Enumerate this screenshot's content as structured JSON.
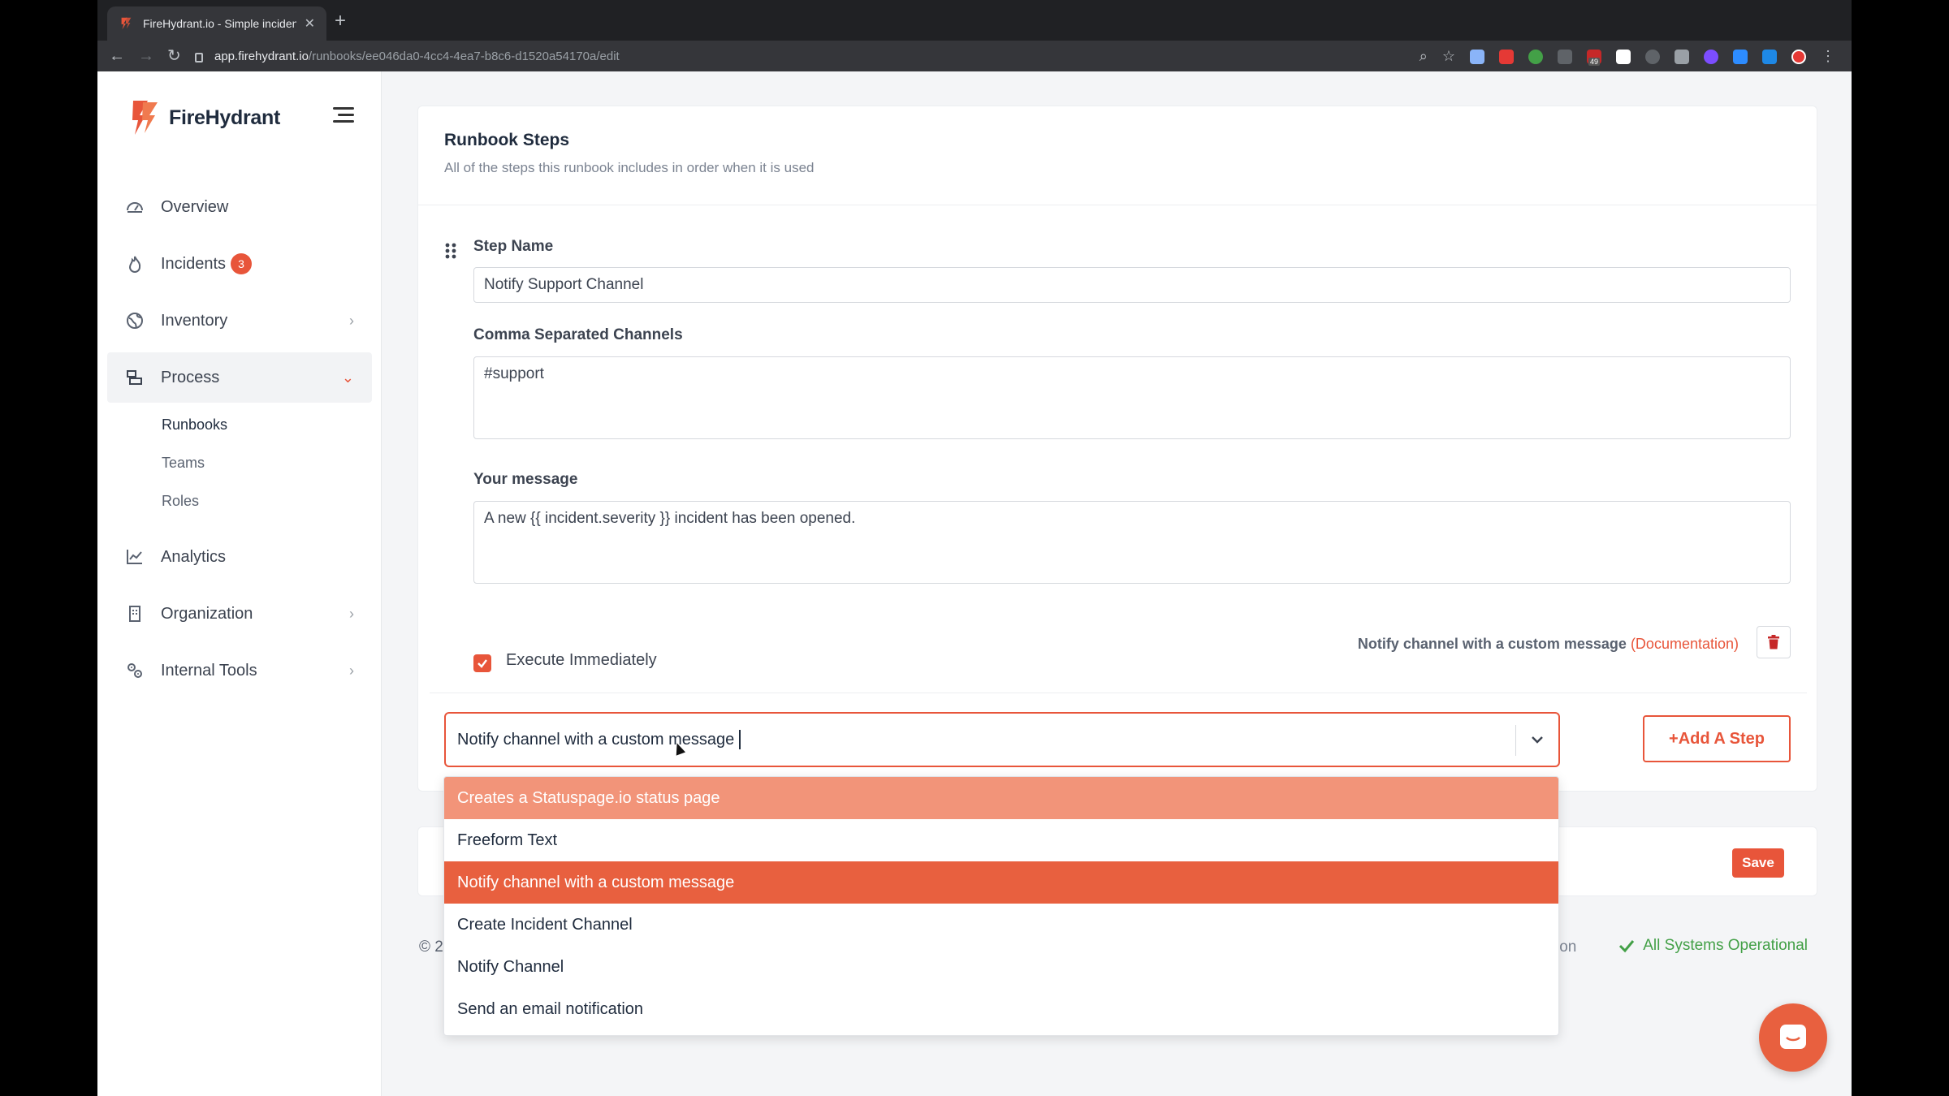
{
  "browser": {
    "tab_title": "FireHydrant.io - Simple incident",
    "tab_close": "✕",
    "new_tab": "+",
    "url_host": "app.firehydrant.io",
    "url_path": "/runbooks/ee046da0-4cc4-4ea7-b8c6-d1520a54170a/edit",
    "ext_badge": "49"
  },
  "sidebar": {
    "brand": "FireHydrant",
    "items": [
      {
        "label": "Overview",
        "icon": "gauge-icon"
      },
      {
        "label": "Incidents",
        "icon": "flame-icon",
        "badge": "3"
      },
      {
        "label": "Inventory",
        "icon": "globe-icon"
      },
      {
        "label": "Process",
        "icon": "process-icon"
      },
      {
        "label": "Analytics",
        "icon": "chart-icon"
      },
      {
        "label": "Organization",
        "icon": "building-icon"
      },
      {
        "label": "Internal Tools",
        "icon": "cogs-icon"
      }
    ],
    "sub_items": [
      "Runbooks",
      "Teams",
      "Roles"
    ]
  },
  "card": {
    "title": "Runbook Steps",
    "subtitle": "All of the steps this runbook includes in order when it is used"
  },
  "step": {
    "name_label": "Step Name",
    "name_value": "Notify Support Channel",
    "channels_label": "Comma Separated Channels",
    "channels_value": "#support",
    "message_label": "Your message",
    "message_value": "A new {{ incident.severity }} incident has been opened.",
    "execute_label": "Execute Immediately",
    "type_note": "Notify channel with a custom message",
    "doc_link": "(Documentation)"
  },
  "select": {
    "value": "Notify channel with a custom message"
  },
  "add_step_label": "+Add A Step",
  "save_label": "Save",
  "footer": {
    "left": "© 2",
    "mid": "ion",
    "status": "All Systems Operational"
  },
  "dropdown": {
    "options": [
      "Creates a Statuspage.io status page",
      "Freeform Text",
      "Notify channel with a custom message",
      "Create Incident Channel",
      "Notify Channel",
      "Send an email notification"
    ]
  },
  "colors": {
    "accent": "#e8553a",
    "status_ok": "#43a047"
  }
}
